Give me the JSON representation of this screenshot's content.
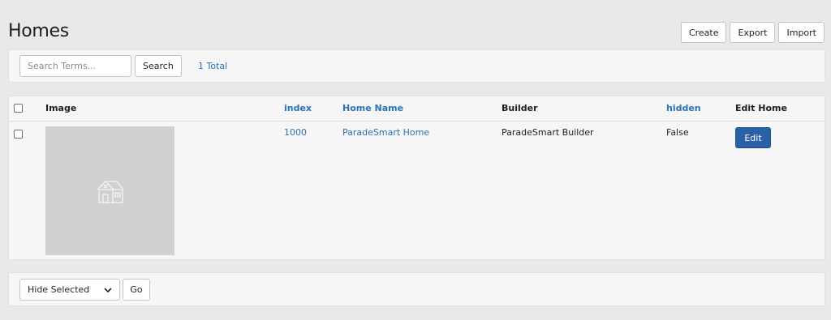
{
  "page": {
    "title": "Homes"
  },
  "toolbar": {
    "create_label": "Create",
    "export_label": "Export",
    "import_label": "Import"
  },
  "search": {
    "placeholder": "Search Terms...",
    "value": "",
    "button_label": "Search",
    "total_label": "1 Total"
  },
  "table": {
    "columns": {
      "image": "Image",
      "index": "index",
      "home_name": "Home Name",
      "builder": "Builder",
      "hidden": "hidden",
      "edit_home": "Edit Home"
    },
    "rows": [
      {
        "image_icon": "house-placeholder-icon",
        "index": "1000",
        "home_name": "ParadeSmart Home",
        "builder": "ParadeSmart Builder",
        "hidden": "False",
        "edit_label": "Edit"
      }
    ]
  },
  "bulk": {
    "selected_action": "Hide Selected",
    "go_label": "Go"
  },
  "colors": {
    "link": "#2a72b5",
    "primary_button": "#2a60a8",
    "page_background": "#e9e9e9",
    "panel_background": "#f6f6f6",
    "placeholder_image": "#d0d0d0"
  }
}
